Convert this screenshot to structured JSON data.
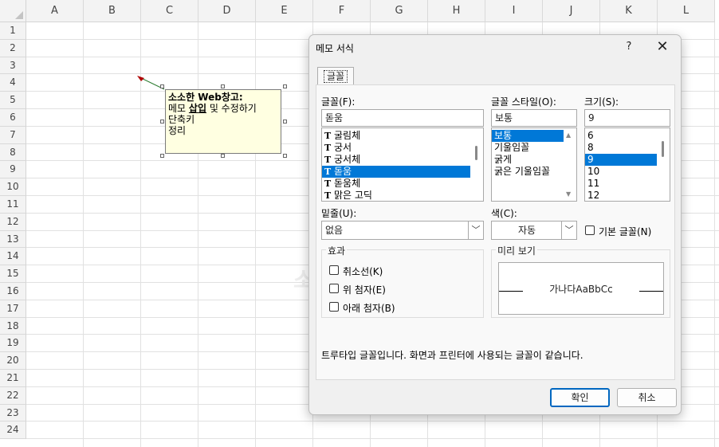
{
  "sheet": {
    "columns": [
      "A",
      "B",
      "C",
      "D",
      "E",
      "F",
      "G",
      "H",
      "I",
      "J",
      "K",
      "L"
    ],
    "rows": [
      "1",
      "2",
      "3",
      "4",
      "5",
      "6",
      "7",
      "8",
      "9",
      "10",
      "11",
      "12",
      "13",
      "14",
      "15",
      "16",
      "17",
      "18",
      "19",
      "20",
      "21",
      "22",
      "23",
      "24"
    ]
  },
  "comment": {
    "line1": "소소한 Web창고:",
    "line2_a": "메모 ",
    "line2_b": "삽입",
    "line2_c": " 및 수정하기",
    "line3": "단축키",
    "line4": "정리"
  },
  "watermark": "소",
  "dialog": {
    "title": "메모 서식",
    "help": "?",
    "close": "✕",
    "tab": "글꼴",
    "font_label": "글꼴(F):",
    "font_value": "돋움",
    "font_list": [
      "굴림체",
      "궁서",
      "궁서체",
      "돋움",
      "돋움체",
      "맑은 고딕"
    ],
    "font_selected": 3,
    "style_label": "글꼴 스타일(O):",
    "style_value": "보통",
    "style_list": [
      "보통",
      "기울임꼴",
      "굵게",
      "굵은 기울임꼴"
    ],
    "style_selected": 0,
    "size_label": "크기(S):",
    "size_value": "9",
    "size_list": [
      "6",
      "8",
      "9",
      "10",
      "11",
      "12"
    ],
    "size_selected": 2,
    "underline_label": "밑줄(U):",
    "underline_value": "없음",
    "color_label": "색(C):",
    "color_value": "자동",
    "normal_font_label": "기본 글꼴(N)",
    "effects_label": "효과",
    "strike_label": "취소선(K)",
    "super_label": "위 첨자(E)",
    "sub_label": "아래 첨자(B)",
    "preview_label": "미리 보기",
    "preview_text": "가나다AaBbCc",
    "info_text": "트루타입 글꼴입니다. 화면과 프린터에 사용되는 글꼴이 같습니다.",
    "ok": "확인",
    "cancel": "취소"
  },
  "colors": {
    "accent": "#0078d7",
    "comment_bg": "#ffffe1"
  }
}
